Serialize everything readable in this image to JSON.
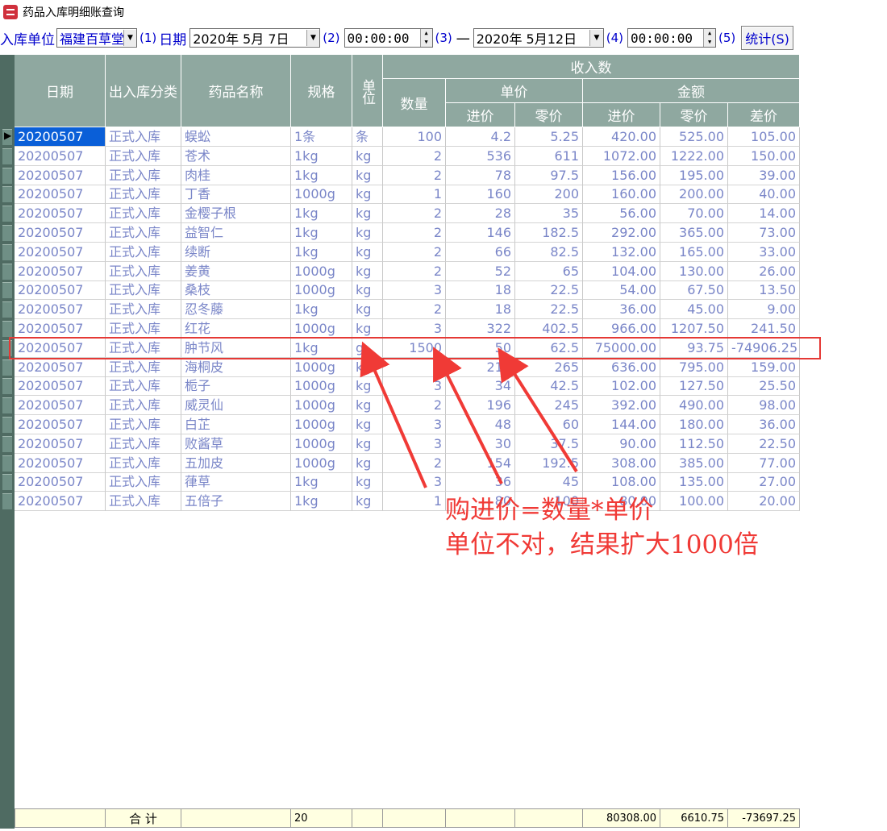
{
  "window": {
    "title": "药品入库明细账查询"
  },
  "toolbar": {
    "unit_label": "入库单位",
    "unit_value": "福建百草堂",
    "link1": "(1)",
    "date_label": "日期",
    "date_from": "2020年  5月  7日",
    "link2": "(2)",
    "time_from": "00:00:00",
    "link3": "(3)",
    "dash": "一",
    "date_to": "2020年  5月12日",
    "link4": "(4)",
    "time_to": "00:00:00",
    "link5": "(5)",
    "stat_button": "统计(S)"
  },
  "header": {
    "date": "日期",
    "category": "出入库分类",
    "drug_name": "药品名称",
    "spec": "规格",
    "unit": "单位",
    "income": "收入数",
    "qty": "数量",
    "unit_price": "单价",
    "amount": "金额",
    "purchase": "进价",
    "retail": "零价",
    "purchase2": "进价",
    "retail2": "零价",
    "diff": "差价"
  },
  "rows": [
    {
      "date": "20200507",
      "cat": "正式入库",
      "name": "蜈蚣",
      "spec": "1条",
      "unit": "条",
      "qty": "100",
      "buy": "4.2",
      "sell": "5.25",
      "amt_buy": "420.00",
      "amt_sell": "525.00",
      "diff": "105.00"
    },
    {
      "date": "20200507",
      "cat": "正式入库",
      "name": "苍术",
      "spec": "1kg",
      "unit": "kg",
      "qty": "2",
      "buy": "536",
      "sell": "611",
      "amt_buy": "1072.00",
      "amt_sell": "1222.00",
      "diff": "150.00"
    },
    {
      "date": "20200507",
      "cat": "正式入库",
      "name": "肉桂",
      "spec": "1kg",
      "unit": "kg",
      "qty": "2",
      "buy": "78",
      "sell": "97.5",
      "amt_buy": "156.00",
      "amt_sell": "195.00",
      "diff": "39.00"
    },
    {
      "date": "20200507",
      "cat": "正式入库",
      "name": "丁香",
      "spec": "1000g",
      "unit": "kg",
      "qty": "1",
      "buy": "160",
      "sell": "200",
      "amt_buy": "160.00",
      "amt_sell": "200.00",
      "diff": "40.00"
    },
    {
      "date": "20200507",
      "cat": "正式入库",
      "name": "金樱子根",
      "spec": "1kg",
      "unit": "kg",
      "qty": "2",
      "buy": "28",
      "sell": "35",
      "amt_buy": "56.00",
      "amt_sell": "70.00",
      "diff": "14.00"
    },
    {
      "date": "20200507",
      "cat": "正式入库",
      "name": "益智仁",
      "spec": "1kg",
      "unit": "kg",
      "qty": "2",
      "buy": "146",
      "sell": "182.5",
      "amt_buy": "292.00",
      "amt_sell": "365.00",
      "diff": "73.00"
    },
    {
      "date": "20200507",
      "cat": "正式入库",
      "name": "续断",
      "spec": "1kg",
      "unit": "kg",
      "qty": "2",
      "buy": "66",
      "sell": "82.5",
      "amt_buy": "132.00",
      "amt_sell": "165.00",
      "diff": "33.00"
    },
    {
      "date": "20200507",
      "cat": "正式入库",
      "name": "姜黄",
      "spec": "1000g",
      "unit": "kg",
      "qty": "2",
      "buy": "52",
      "sell": "65",
      "amt_buy": "104.00",
      "amt_sell": "130.00",
      "diff": "26.00"
    },
    {
      "date": "20200507",
      "cat": "正式入库",
      "name": "桑枝",
      "spec": "1000g",
      "unit": "kg",
      "qty": "3",
      "buy": "18",
      "sell": "22.5",
      "amt_buy": "54.00",
      "amt_sell": "67.50",
      "diff": "13.50"
    },
    {
      "date": "20200507",
      "cat": "正式入库",
      "name": "忍冬藤",
      "spec": "1kg",
      "unit": "kg",
      "qty": "2",
      "buy": "18",
      "sell": "22.5",
      "amt_buy": "36.00",
      "amt_sell": "45.00",
      "diff": "9.00"
    },
    {
      "date": "20200507",
      "cat": "正式入库",
      "name": "红花",
      "spec": "1000g",
      "unit": "kg",
      "qty": "3",
      "buy": "322",
      "sell": "402.5",
      "amt_buy": "966.00",
      "amt_sell": "1207.50",
      "diff": "241.50"
    },
    {
      "date": "20200507",
      "cat": "正式入库",
      "name": "肿节风",
      "spec": "1kg",
      "unit": "g",
      "qty": "1500",
      "buy": "50",
      "sell": "62.5",
      "amt_buy": "75000.00",
      "amt_sell": "93.75",
      "diff": "-74906.25"
    },
    {
      "date": "20200507",
      "cat": "正式入库",
      "name": "海桐皮",
      "spec": "1000g",
      "unit": "kg",
      "qty": "3",
      "buy": "212",
      "sell": "265",
      "amt_buy": "636.00",
      "amt_sell": "795.00",
      "diff": "159.00"
    },
    {
      "date": "20200507",
      "cat": "正式入库",
      "name": "栀子",
      "spec": "1000g",
      "unit": "kg",
      "qty": "3",
      "buy": "34",
      "sell": "42.5",
      "amt_buy": "102.00",
      "amt_sell": "127.50",
      "diff": "25.50"
    },
    {
      "date": "20200507",
      "cat": "正式入库",
      "name": "威灵仙",
      "spec": "1000g",
      "unit": "kg",
      "qty": "2",
      "buy": "196",
      "sell": "245",
      "amt_buy": "392.00",
      "amt_sell": "490.00",
      "diff": "98.00"
    },
    {
      "date": "20200507",
      "cat": "正式入库",
      "name": "白芷",
      "spec": "1000g",
      "unit": "kg",
      "qty": "3",
      "buy": "48",
      "sell": "60",
      "amt_buy": "144.00",
      "amt_sell": "180.00",
      "diff": "36.00"
    },
    {
      "date": "20200507",
      "cat": "正式入库",
      "name": "败酱草",
      "spec": "1000g",
      "unit": "kg",
      "qty": "3",
      "buy": "30",
      "sell": "37.5",
      "amt_buy": "90.00",
      "amt_sell": "112.50",
      "diff": "22.50"
    },
    {
      "date": "20200507",
      "cat": "正式入库",
      "name": "五加皮",
      "spec": "1000g",
      "unit": "kg",
      "qty": "2",
      "buy": "154",
      "sell": "192.5",
      "amt_buy": "308.00",
      "amt_sell": "385.00",
      "diff": "77.00"
    },
    {
      "date": "20200507",
      "cat": "正式入库",
      "name": "葎草",
      "spec": "1kg",
      "unit": "kg",
      "qty": "3",
      "buy": "36",
      "sell": "45",
      "amt_buy": "108.00",
      "amt_sell": "135.00",
      "diff": "27.00"
    },
    {
      "date": "20200507",
      "cat": "正式入库",
      "name": "五倍子",
      "spec": "1kg",
      "unit": "kg",
      "qty": "1",
      "buy": "80",
      "sell": "100",
      "amt_buy": "80.00",
      "amt_sell": "100.00",
      "diff": "20.00"
    }
  ],
  "footer": {
    "label": "合 计",
    "count": "20",
    "sum_buy": "80308.00",
    "sum_sell": "6610.75",
    "sum_diff": "-73697.25"
  },
  "annotation": {
    "line1": "购进价=数量*单价",
    "line2": "单位不对，结果扩大1000倍",
    "color": "#f03a36"
  }
}
